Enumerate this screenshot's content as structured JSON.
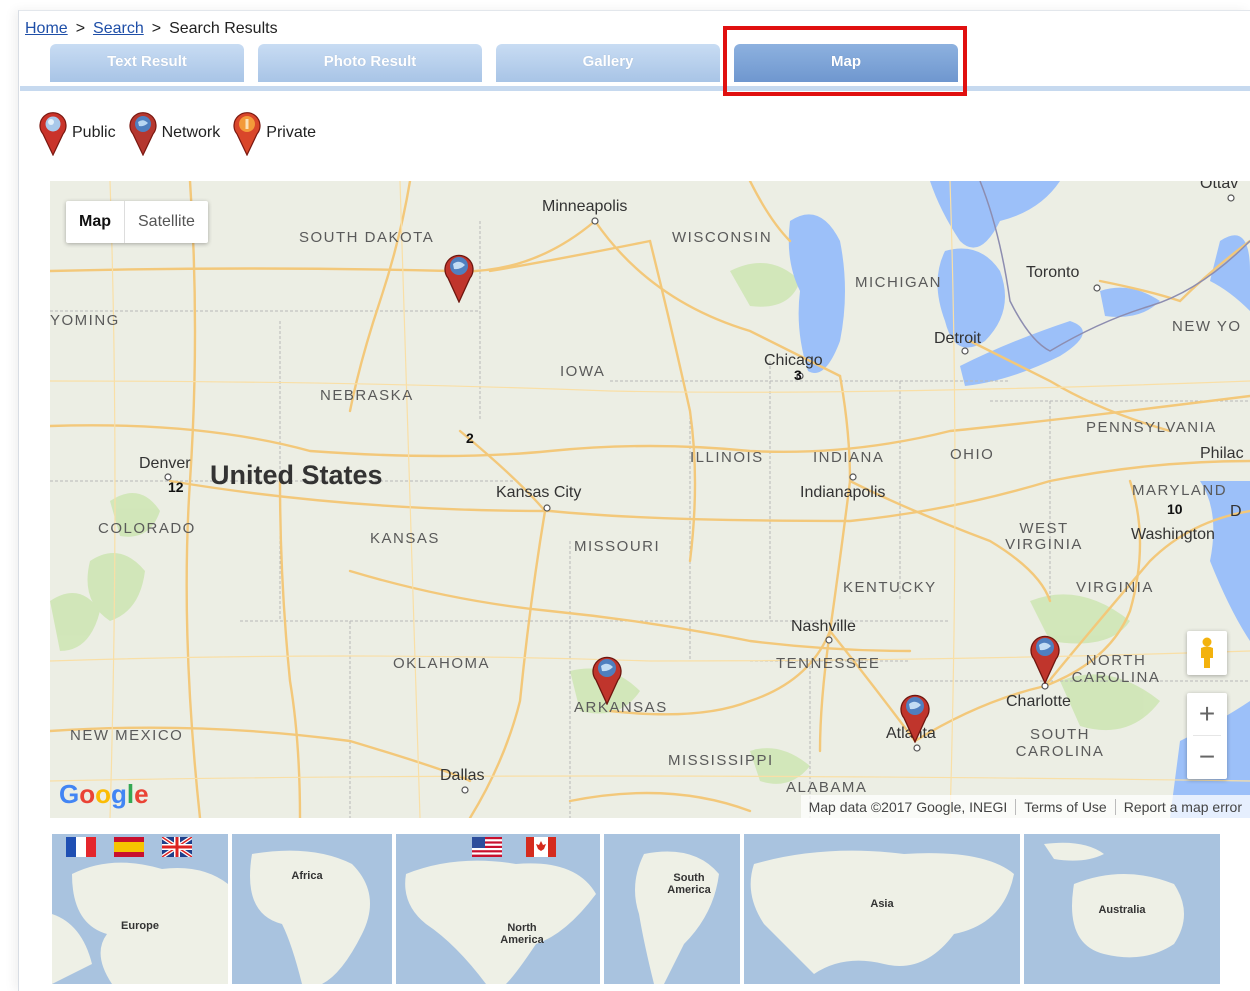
{
  "breadcrumb": {
    "home": "Home",
    "search": "Search",
    "sep": ">",
    "current": "Search Results"
  },
  "tabs": [
    {
      "label": "Text Result",
      "active": false
    },
    {
      "label": "Photo Result",
      "active": false
    },
    {
      "label": "Gallery",
      "active": false
    },
    {
      "label": "Map",
      "active": true
    }
  ],
  "legend": [
    {
      "label": "Public",
      "icon": "red-pin-icon"
    },
    {
      "label": "Network",
      "icon": "blue-pin-icon"
    },
    {
      "label": "Private",
      "icon": "orange-pin-icon"
    }
  ],
  "map": {
    "type_control": {
      "map": "Map",
      "satellite": "Satellite"
    },
    "country": "United States",
    "states": [
      "SOUTH DAKOTA",
      "WISCONSIN",
      "MICHIGAN",
      "YOMING",
      "NEBRASKA",
      "IOWA",
      "ILLINOIS",
      "INDIANA",
      "OHIO",
      "PENNSYLVANIA",
      "COLORADO",
      "KANSAS",
      "MISSOURI",
      "MARYLAND",
      "WEST VIRGINIA",
      "KENTUCKY",
      "VIRGINIA",
      "OKLAHOMA",
      "TENNESSEE",
      "ARKANSAS",
      "NORTH CAROLINA",
      "NEW MEXICO",
      "MISSISSIPPI",
      "SOUTH CAROLINA",
      "ALABAMA",
      "NEW YO"
    ],
    "cities": [
      "Minneapolis",
      "Toronto",
      "Ottav",
      "Detroit",
      "Chicago",
      "Philac",
      "Denver",
      "Kansas City",
      "Indianapolis",
      "Washington",
      "Nashville",
      "Charlotte",
      "Atlanta",
      "Dallas",
      "D"
    ],
    "counts": [
      "3",
      "2",
      "12",
      "10"
    ],
    "google": "Google",
    "attribution": {
      "data": "Map data ©2017 Google, INEGI",
      "terms": "Terms of Use",
      "report": "Report a map error"
    },
    "colors": {
      "water": "#9cc0f9",
      "land": "#eceee4",
      "road": "#f3c87a",
      "park": "#cde5b4"
    }
  },
  "thumbnails": [
    {
      "label": "Europe"
    },
    {
      "label": "Africa"
    },
    {
      "label": "North America"
    },
    {
      "label": "South America"
    },
    {
      "label": "Asia"
    },
    {
      "label": "Australia"
    }
  ],
  "flags": [
    "france-flag-icon",
    "spain-flag-icon",
    "uk-flag-icon",
    "usa-flag-icon",
    "canada-flag-icon"
  ]
}
